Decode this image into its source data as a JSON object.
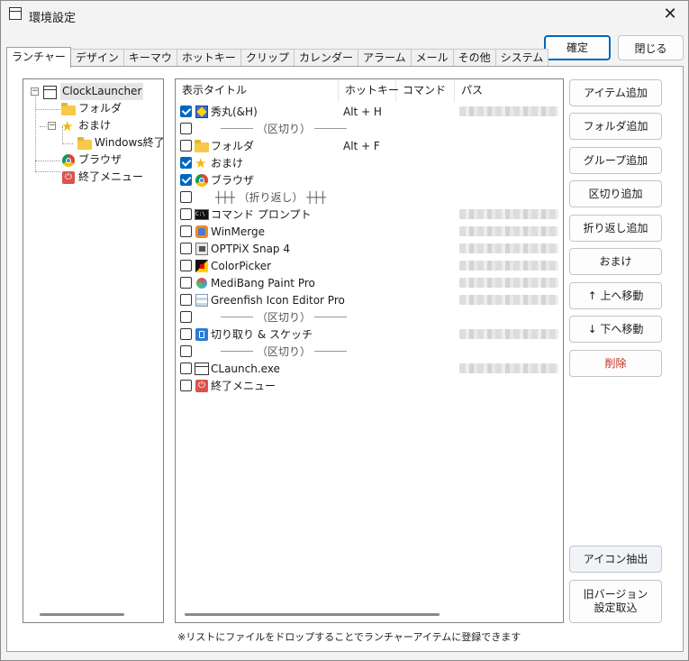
{
  "window": {
    "title": "環境設定"
  },
  "buttons": {
    "ok": "確定",
    "close": "閉じる"
  },
  "tabs": [
    "ランチャー",
    "デザイン",
    "キーマウ",
    "ホットキー",
    "クリップ",
    "カレンダー",
    "アラーム",
    "メール",
    "その他",
    "システム"
  ],
  "tree": {
    "root": "ClockLauncher",
    "nodes": [
      "フォルダ",
      "おまけ",
      "Windows終了",
      "ブラウザ",
      "終了メニュー"
    ]
  },
  "list": {
    "columns": [
      "表示タイトル",
      "ホットキー",
      "コマンド",
      "パス"
    ],
    "rows": [
      {
        "title": "秀丸(&H)",
        "hotkey": "Alt + H",
        "checked": true,
        "icon": "hidemaru-icon"
      },
      {
        "title": "（区切り）",
        "hotkey": "",
        "checked": false,
        "icon": "separator"
      },
      {
        "title": "フォルダ",
        "hotkey": "Alt + F",
        "checked": false,
        "icon": "folder-icon"
      },
      {
        "title": "おまけ",
        "hotkey": "",
        "checked": true,
        "icon": "star-icon"
      },
      {
        "title": "ブラウザ",
        "hotkey": "",
        "checked": true,
        "icon": "chrome-icon"
      },
      {
        "title": "（折り返し）",
        "hotkey": "",
        "checked": false,
        "icon": "wrap"
      },
      {
        "title": "コマンド プロンプト",
        "hotkey": "",
        "checked": false,
        "icon": "cmd-icon"
      },
      {
        "title": "WinMerge",
        "hotkey": "",
        "checked": false,
        "icon": "winmerge-icon"
      },
      {
        "title": "OPTPiX Snap 4",
        "hotkey": "",
        "checked": false,
        "icon": "optpix-icon"
      },
      {
        "title": "ColorPicker",
        "hotkey": "",
        "checked": false,
        "icon": "colorpicker-icon"
      },
      {
        "title": "MediBang Paint Pro",
        "hotkey": "",
        "checked": false,
        "icon": "medibang-icon"
      },
      {
        "title": "Greenfish Icon Editor Pro",
        "hotkey": "",
        "checked": false,
        "icon": "greenfish-icon"
      },
      {
        "title": "（区切り）",
        "hotkey": "",
        "checked": false,
        "icon": "separator"
      },
      {
        "title": "切り取り & スケッチ",
        "hotkey": "",
        "checked": false,
        "icon": "snip-icon"
      },
      {
        "title": "（区切り）",
        "hotkey": "",
        "checked": false,
        "icon": "separator"
      },
      {
        "title": "CLaunch.exe",
        "hotkey": "",
        "checked": false,
        "icon": "app-window-icon"
      },
      {
        "title": "終了メニュー",
        "hotkey": "",
        "checked": false,
        "icon": "power-icon"
      }
    ]
  },
  "side_buttons": {
    "add_item": "アイテム追加",
    "add_folder": "フォルダ追加",
    "add_group": "グループ追加",
    "add_separator": "区切り追加",
    "add_wrap": "折り返し追加",
    "omake": "おまけ",
    "move_up": "↑ 上へ移動",
    "move_down": "↓ 下へ移動",
    "delete": "削除",
    "extract_icon": "アイコン抽出",
    "legacy_import_line1": "旧バージョン",
    "legacy_import_line2": "設定取込"
  },
  "hint": "※リストにファイルをドロップすることでランチャーアイテムに登録できます",
  "colors": {
    "accent": "#0067c0",
    "danger": "#c42b1c"
  }
}
